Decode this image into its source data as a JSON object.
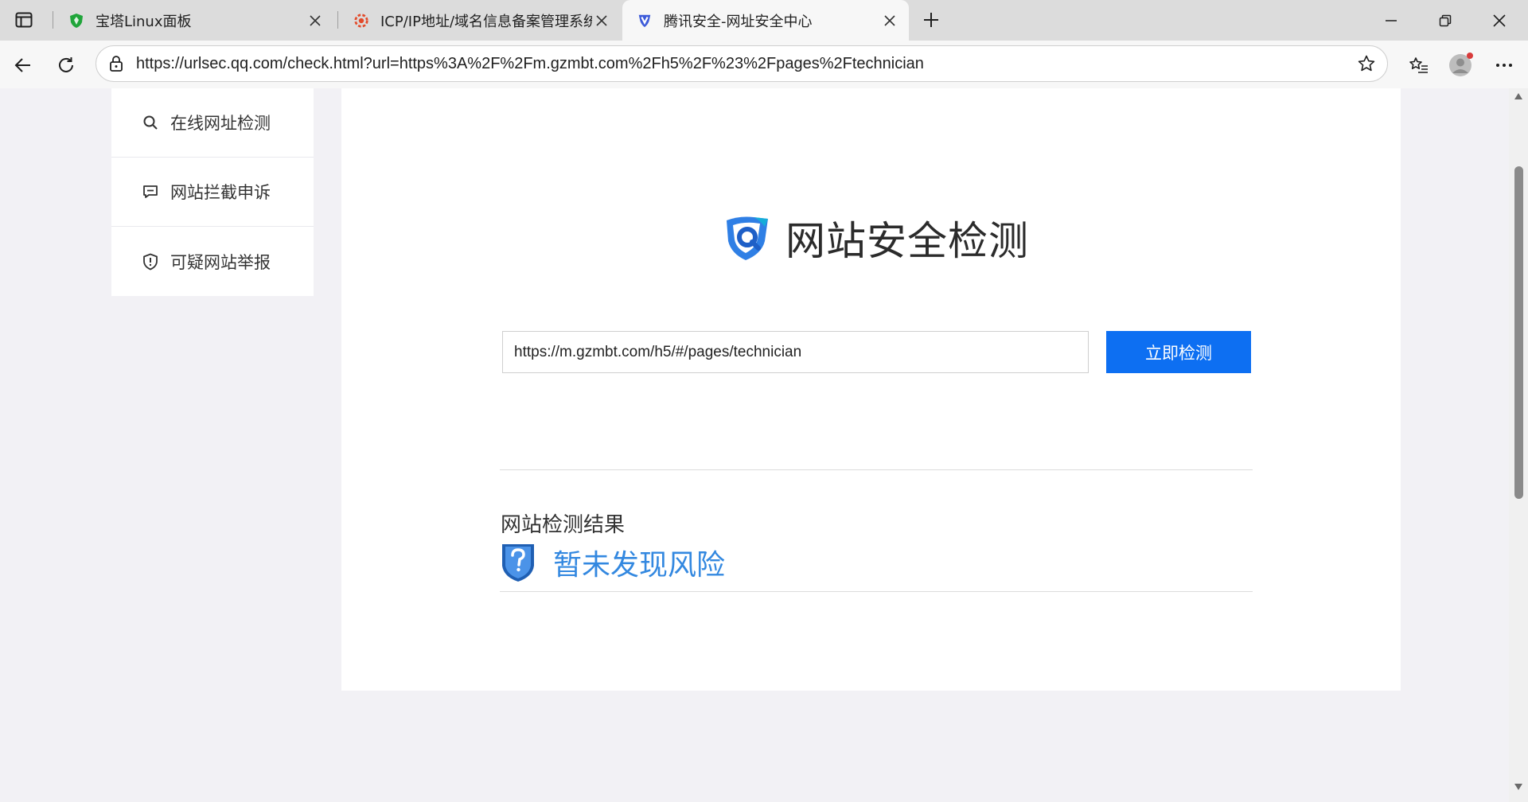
{
  "browser": {
    "tabs": [
      {
        "title": "宝塔Linux面板",
        "favicon": "baota-shield-icon",
        "active": false
      },
      {
        "title": "ICP/IP地址/域名信息备案管理系统",
        "favicon": "miit-emblem-icon",
        "active": false
      },
      {
        "title": "腾讯安全-网址安全中心",
        "favicon": "tencent-security-icon",
        "active": true
      }
    ],
    "address_url": "https://urlsec.qq.com/check.html?url=https%3A%2F%2Fm.gzmbt.com%2Fh5%2F%23%2Fpages%2Ftechnician",
    "colors": {
      "tab_strip": "#dcdcdc",
      "toolbar": "#f7f7f7",
      "notification_dot": "#d83b3b"
    }
  },
  "page": {
    "sidebar": {
      "items": [
        {
          "label": "在线网址检测",
          "icon": "search-icon"
        },
        {
          "label": "网站拦截申诉",
          "icon": "chat-bubble-icon"
        },
        {
          "label": "可疑网站举报",
          "icon": "shield-alert-icon"
        }
      ]
    },
    "brand_title": "网站安全检测",
    "search": {
      "value": "https://m.gzmbt.com/h5/#/pages/technician"
    },
    "check_button_label": "立即检测",
    "result": {
      "heading": "网站检测结果",
      "status_text": "暂未发现风险",
      "status_icon": "question-shield-icon"
    },
    "colors": {
      "primary": "#0d6ff2",
      "result_text": "#3388e0",
      "background": "#f2f1f5"
    }
  }
}
